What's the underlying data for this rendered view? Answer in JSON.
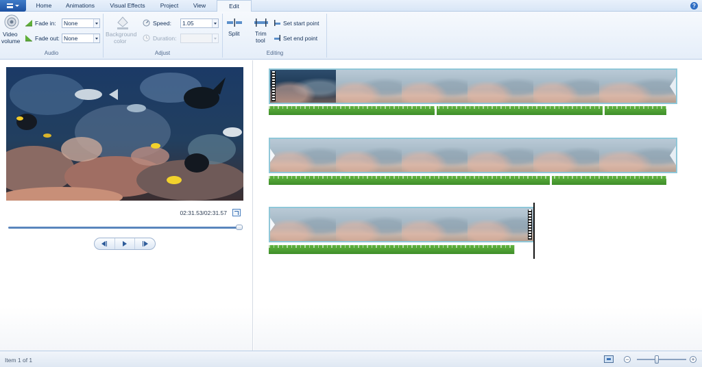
{
  "ribbon": {
    "tabs": [
      "Home",
      "Animations",
      "Visual Effects",
      "Project",
      "View",
      "Edit"
    ],
    "active_tab": "Edit",
    "audio": {
      "video_volume_label": [
        "Video",
        "volume"
      ],
      "fade_in_label": "Fade in:",
      "fade_in_value": "None",
      "fade_out_label": "Fade out:",
      "fade_out_value": "None",
      "group_label": "Audio"
    },
    "adjust": {
      "background_color_label": [
        "Background",
        "color"
      ],
      "speed_label": "Speed:",
      "speed_value": "1.05",
      "duration_label": "Duration:",
      "duration_value": "",
      "group_label": "Adjust"
    },
    "editing": {
      "split_label": "Split",
      "trim_label": [
        "Trim",
        "tool"
      ],
      "set_start_label": "Set start point",
      "set_end_label": "Set end point",
      "group_label": "Editing"
    }
  },
  "preview": {
    "time": "02:31.53/02:31.57",
    "seek_progress": 0.99
  },
  "status": {
    "text": "Item 1 of 1",
    "zoom_out_symbol": "−",
    "zoom_in_symbol": "+"
  },
  "icons": {
    "app_menu": "app-menu-icon",
    "help": "help-icon",
    "fullscreen": "fullscreen-icon",
    "monitor": "monitor-icon"
  },
  "colors": {
    "accent": "#2f6ec4",
    "clip_border": "#8fc7d8",
    "audio_waveform": "#4fa034"
  }
}
